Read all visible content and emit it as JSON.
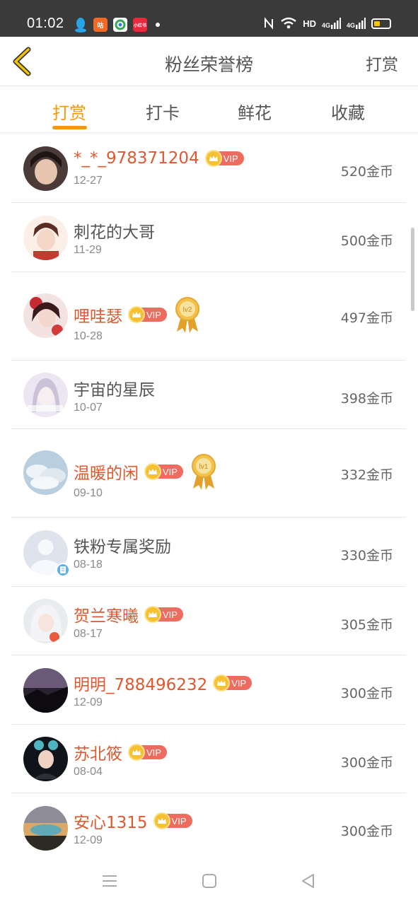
{
  "status_bar": {
    "time": "01:02",
    "network": "HD",
    "signal_1": "4G",
    "signal_2": "4G",
    "badge_app_text": "小红书",
    "badge_app_text_2": "咕"
  },
  "header": {
    "title": "粉丝荣誉榜",
    "right_action": "打赏"
  },
  "tabs": [
    {
      "label": "打赏",
      "active": true
    },
    {
      "label": "打卡",
      "active": false
    },
    {
      "label": "鲜花",
      "active": false
    },
    {
      "label": "收藏",
      "active": false
    }
  ],
  "colors": {
    "accent": "#f29a0d",
    "vip_name": "#e0582e",
    "vip_badge": "#ee6c5f"
  },
  "fans": [
    {
      "name": "*_*_978371204",
      "date": "12-27",
      "amount": "520金币",
      "vip": true,
      "vip_label": "VIP",
      "medal": ""
    },
    {
      "name": "刺花的大哥",
      "date": "11-29",
      "amount": "500金币",
      "vip": false,
      "vip_label": "",
      "medal": ""
    },
    {
      "name": "哩哇瑟",
      "date": "10-28",
      "amount": "497金币",
      "vip": true,
      "vip_label": "VIP",
      "medal": "lv2"
    },
    {
      "name": "宇宙的星辰",
      "date": "10-07",
      "amount": "398金币",
      "vip": false,
      "vip_label": "",
      "medal": ""
    },
    {
      "name": "温暖的闲",
      "date": "09-10",
      "amount": "332金币",
      "vip": true,
      "vip_label": "VIP",
      "medal": "lv1"
    },
    {
      "name": "铁粉专属奖励",
      "date": "08-18",
      "amount": "330金币",
      "vip": false,
      "vip_label": "",
      "medal": ""
    },
    {
      "name": "贺兰寒曦",
      "date": "08-17",
      "amount": "305金币",
      "vip": true,
      "vip_label": "VIP",
      "medal": ""
    },
    {
      "name": "明明_788496232",
      "date": "12-09",
      "amount": "300金币",
      "vip": true,
      "vip_label": "VIP",
      "medal": ""
    },
    {
      "name": "苏北筱",
      "date": "08-04",
      "amount": "300金币",
      "vip": true,
      "vip_label": "VIP",
      "medal": ""
    },
    {
      "name": "安心1315",
      "date": "12-09",
      "amount": "300金币",
      "vip": true,
      "vip_label": "VIP",
      "medal": ""
    }
  ],
  "icons": {
    "back": "chevron-left-icon",
    "nav_menu": "menu-icon",
    "nav_home": "home-square-icon",
    "nav_back": "back-triangle-icon"
  }
}
